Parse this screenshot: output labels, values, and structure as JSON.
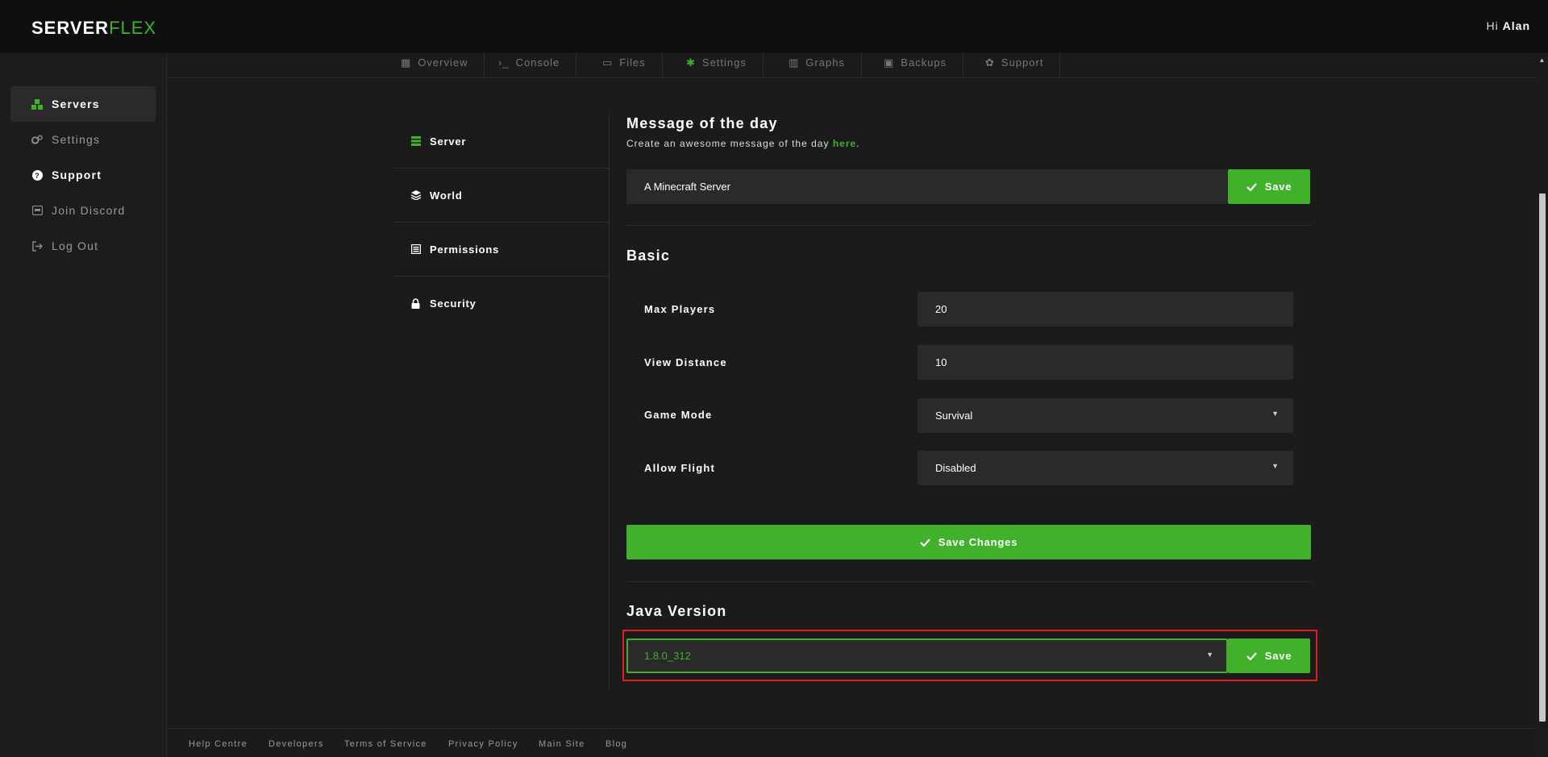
{
  "header": {
    "logo_part1": "SERVER",
    "logo_part2": "FLEX",
    "greeting_prefix": "Hi",
    "user_name": "Alan"
  },
  "sidebar": {
    "items": [
      {
        "label": "Servers",
        "icon": "servers-icon"
      },
      {
        "label": "Settings",
        "icon": "gears-icon"
      },
      {
        "label": "Support",
        "icon": "question-circle-icon"
      },
      {
        "label": "Join Discord",
        "icon": "discord-icon"
      },
      {
        "label": "Log Out",
        "icon": "logout-icon"
      }
    ]
  },
  "tabs": [
    "Overview",
    "Console",
    "Files",
    "Settings",
    "Graphs",
    "Backups",
    "Support"
  ],
  "submenu": [
    "Server",
    "World",
    "Permissions",
    "Security"
  ],
  "motd": {
    "title": "Message of the day",
    "desc_prefix": "Create an awesome message of the day",
    "desc_link": "here",
    "desc_suffix": ".",
    "value": "A Minecraft Server",
    "save_label": "Save"
  },
  "basic": {
    "title": "Basic",
    "fields": [
      {
        "label": "Max Players",
        "value": "20"
      },
      {
        "label": "View Distance",
        "value": "10"
      },
      {
        "label": "Game Mode",
        "value": "Survival"
      },
      {
        "label": "Allow Flight",
        "value": "Disabled"
      }
    ],
    "save_changes_label": "Save Changes"
  },
  "java": {
    "title": "Java Version",
    "value": "1.8.0_312",
    "save_label": "Save"
  },
  "footer": [
    "Help Centre",
    "Developers",
    "Terms of Service",
    "Privacy Policy",
    "Main Site",
    "Blog"
  ],
  "colors": {
    "accent": "#41b12b",
    "highlight": "#e01b1b",
    "background": "#1c1c1c",
    "topbar": "#0f0f0f"
  }
}
